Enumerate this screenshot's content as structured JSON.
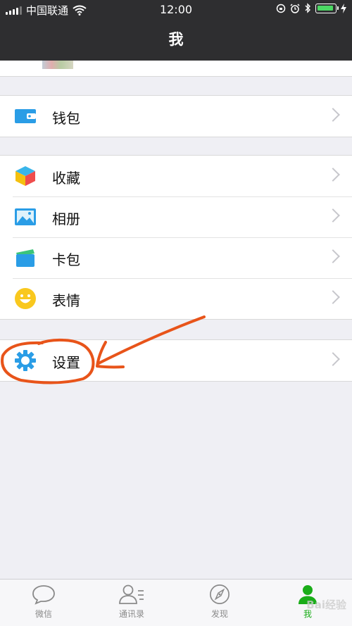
{
  "status": {
    "carrier": "中国联通",
    "time": "12:00"
  },
  "nav": {
    "title": "我"
  },
  "groups": [
    {
      "items": [
        {
          "label": "钱包",
          "icon": "wallet-icon"
        }
      ]
    },
    {
      "items": [
        {
          "label": "收藏",
          "icon": "favorites-cube-icon"
        },
        {
          "label": "相册",
          "icon": "album-photo-icon"
        },
        {
          "label": "卡包",
          "icon": "card-pack-icon"
        },
        {
          "label": "表情",
          "icon": "smiley-icon"
        }
      ]
    },
    {
      "items": [
        {
          "label": "设置",
          "icon": "gear-icon"
        }
      ]
    }
  ],
  "tabbar": {
    "tabs": [
      {
        "label": "微信",
        "icon": "chat-bubble-icon"
      },
      {
        "label": "通讯录",
        "icon": "contacts-icon"
      },
      {
        "label": "发现",
        "icon": "compass-icon"
      },
      {
        "label": "我",
        "icon": "person-icon",
        "active": true
      }
    ]
  },
  "watermark": "Bai经验",
  "colors": {
    "accent": "#1aad19",
    "annotation": "#e8541a",
    "navbar": "#2e2e30"
  }
}
